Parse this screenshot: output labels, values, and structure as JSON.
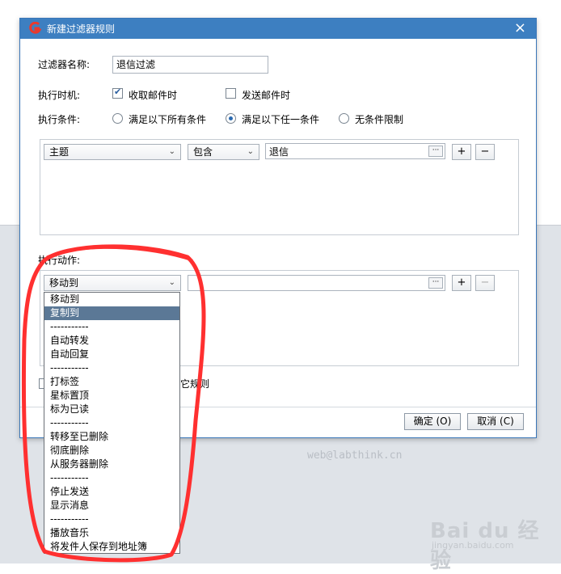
{
  "dialog": {
    "title": "新建过滤器规则",
    "close_label": "×"
  },
  "form": {
    "name_label": "过滤器名称:",
    "name_value": "退信过滤",
    "timing_label": "执行时机:",
    "timing_receive": "收取邮件时",
    "timing_receive_checked": true,
    "timing_send": "发送邮件时",
    "timing_send_checked": false,
    "condition_label": "执行条件:",
    "condition_options": [
      "满足以下所有条件",
      "满足以下任一条件",
      "无条件限制"
    ],
    "condition_selected": 1
  },
  "condition_row": {
    "field": "主题",
    "operator": "包含",
    "value": "退信",
    "browse_label": "···",
    "add_label": "+",
    "remove_label": "−"
  },
  "action": {
    "label": "执行动作:",
    "selected": "移动到",
    "browse_label": "···",
    "add_label": "+",
    "remove_label": "−",
    "stop_rules_label": "它规则"
  },
  "dropdown": {
    "items": [
      "移动到",
      "复制到",
      "-----------",
      "自动转发",
      "自动回复",
      "-----------",
      "打标签",
      "星标置顶",
      "标为已读",
      "-----------",
      "转移至已删除",
      "彻底删除",
      "从服务器删除",
      "-----------",
      "停止发送",
      "显示消息",
      "-----------",
      "播放音乐",
      "将发件人保存到地址簿"
    ],
    "highlighted_index": 1
  },
  "buttons": {
    "ok": "确定 (O)",
    "cancel": "取消 (C)"
  },
  "watermark": {
    "text": "web@labthink.cn",
    "brand": "Bai du 经验",
    "brand_sub": "jingyan.baidu.com"
  },
  "colors": {
    "titlebar": "#3d7fc1",
    "highlight": "#5b7896",
    "annotation": "#ff3030"
  }
}
